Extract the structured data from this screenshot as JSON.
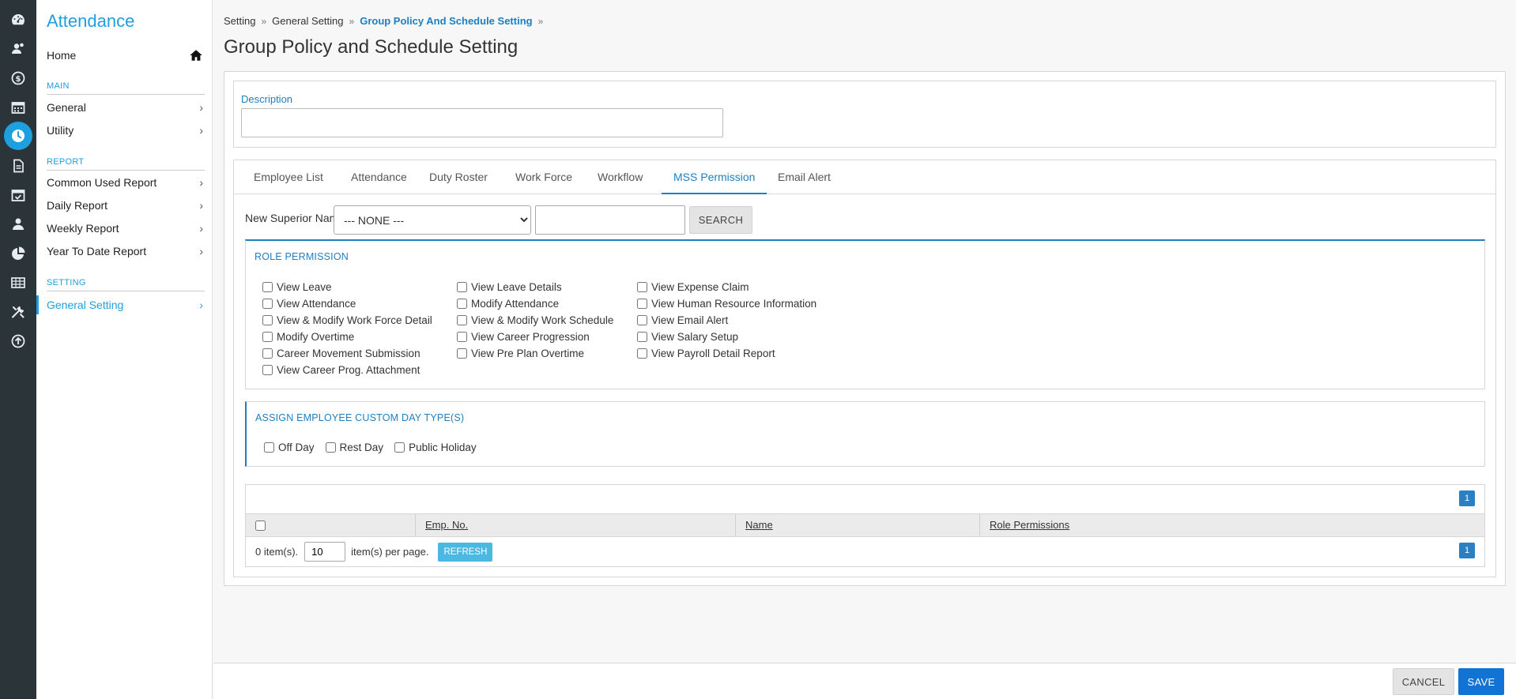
{
  "rail": {
    "icons": [
      "dashboard-icon",
      "users-icon",
      "payroll-icon",
      "calendar-icon",
      "clock-icon",
      "document-icon",
      "calendar-check-icon",
      "people-icon",
      "pie-chart-icon",
      "table-icon",
      "tools-icon",
      "upload-icon"
    ],
    "active": "clock-icon"
  },
  "sidebar": {
    "app_title": "Attendance",
    "home_label": "Home",
    "sections": [
      {
        "label": "MAIN",
        "items": [
          "General",
          "Utility"
        ]
      },
      {
        "label": "REPORT",
        "items": [
          "Common Used Report",
          "Daily Report",
          "Weekly Report",
          "Year To Date Report"
        ]
      },
      {
        "label": "SETTING",
        "items": [
          "General Setting"
        ]
      }
    ],
    "chevron": "›"
  },
  "breadcrumb": {
    "items": [
      "Setting",
      "General Setting",
      "Group Policy And Schedule Setting"
    ],
    "separator": "»"
  },
  "page_title": "Group Policy and Schedule Setting",
  "description": {
    "label": "Description",
    "value": ""
  },
  "tabs": [
    {
      "label": "Employee List"
    },
    {
      "label": "Attendance"
    },
    {
      "label": "Duty Roster"
    },
    {
      "label": "Work Force"
    },
    {
      "label": "Workflow"
    },
    {
      "label": "MSS Permission",
      "active": true
    },
    {
      "label": "Email Alert"
    }
  ],
  "superior": {
    "label": "New Superior Name:",
    "selected": "--- NONE ---",
    "text_value": "",
    "search_label": "SEARCH"
  },
  "role_permission": {
    "heading": "ROLE PERMISSION",
    "columns": [
      [
        "View Leave",
        "View Attendance",
        "View & Modify Work Force Detail",
        "Modify Overtime",
        "Career Movement Submission",
        "View Career Prog. Attachment"
      ],
      [
        "View Leave Details",
        "Modify Attendance",
        "View & Modify Work Schedule",
        "View Career Progression",
        "View Pre Plan Overtime"
      ],
      [
        "View Expense Claim",
        "View Human Resource Information",
        "View Email Alert",
        "View Salary Setup",
        "View Payroll Detail Report"
      ]
    ]
  },
  "day_types": {
    "heading": "ASSIGN EMPLOYEE CUSTOM DAY TYPE(S)",
    "options": [
      "Off Day",
      "Rest Day",
      "Public Holiday"
    ]
  },
  "grid": {
    "columns": [
      "Emp. No.",
      "Name",
      "Role Permissions"
    ],
    "item_count": "0 item(s).",
    "per_page_value": "10",
    "per_page_label": "item(s) per page.",
    "refresh_label": "REFRESH",
    "page": "1"
  },
  "footer": {
    "cancel_label": "CANCEL",
    "save_label": "SAVE"
  },
  "colors": {
    "accent": "#1e9fe0",
    "rail": "#2b3539",
    "save": "#1173d4"
  }
}
